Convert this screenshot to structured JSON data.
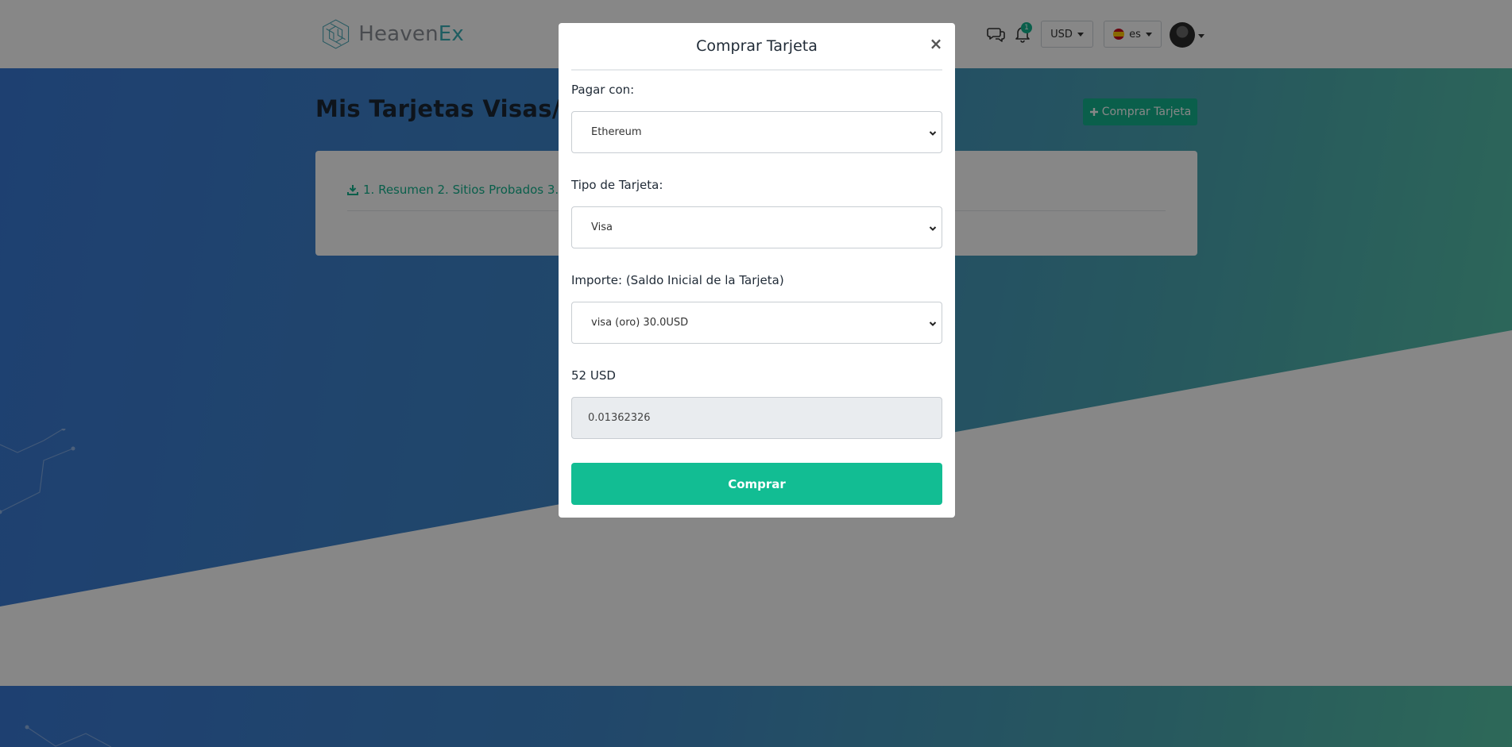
{
  "header": {
    "logo": {
      "text_main": "Heaven",
      "text_accent": "Ex"
    },
    "notification_count": "1",
    "currency": "USD",
    "language": "es"
  },
  "page": {
    "title": "Mis Tarjetas Visas/Mas",
    "buy_button_label": "Comprar Tarjeta",
    "panel_link": "1. Resumen 2. Sitios Probados 3. Con"
  },
  "modal": {
    "title": "Comprar Tarjeta",
    "close_symbol": "×",
    "pay_with": {
      "label": "Pagar con:",
      "selected": "Ethereum"
    },
    "card_type": {
      "label": "Tipo de Tarjeta:",
      "selected": "Visa"
    },
    "amount": {
      "label": "Importe: (Saldo Inicial de la Tarjeta)",
      "selected": "visa (oro) 30.0USD"
    },
    "total": {
      "label": "52 USD",
      "value": "0.01362326"
    },
    "submit_label": "Comprar"
  },
  "colors": {
    "accent": "#13b38f",
    "hero_start": "#3a7ad6",
    "hero_end": "#56c6a8",
    "overlay": "rgba(0,0,0,0.47)"
  },
  "icons": [
    "logo-icon",
    "chat-icon",
    "bell-icon",
    "download-icon",
    "plus-icon",
    "chevron-down-icon",
    "close-icon",
    "flag-icon"
  ]
}
